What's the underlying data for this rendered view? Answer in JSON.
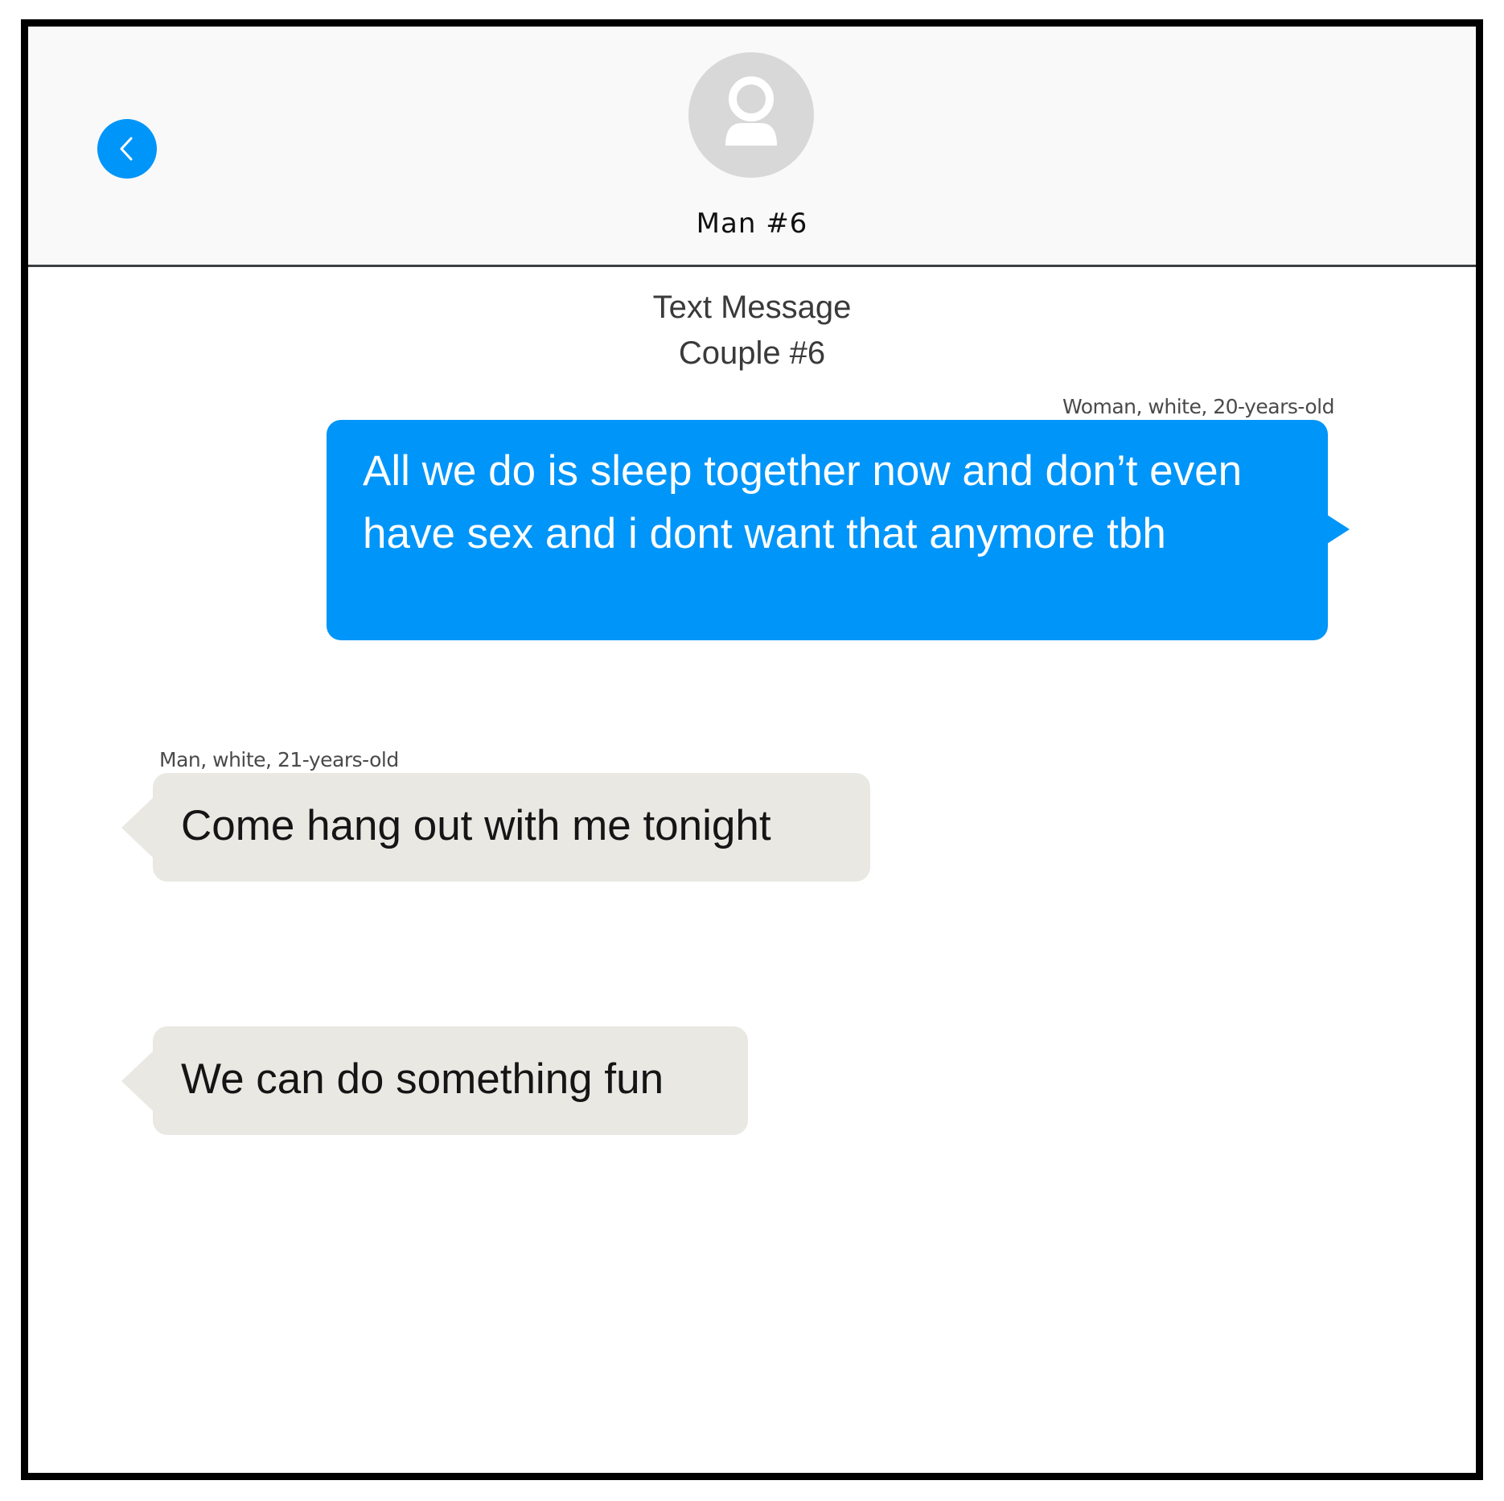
{
  "header": {
    "back_icon": "chevron-left-icon",
    "avatar_icon": "person-icon",
    "contact_name": "Man #6"
  },
  "conversation": {
    "subtitle_line1": "Text Message",
    "subtitle_line2": "Couple #6"
  },
  "messages": [
    {
      "direction": "outgoing",
      "sender": "Woman, white, 20-years-old",
      "text": "All we do is sleep together now and don’t even have sex and i dont want that anymore tbh"
    },
    {
      "direction": "incoming",
      "sender": "Man, white, 21-years-old",
      "text": "Come hang out with me tonight"
    },
    {
      "direction": "incoming",
      "sender": "",
      "text": "We can do something fun"
    }
  ],
  "colors": {
    "outgoing_bubble": "#0095f9",
    "incoming_bubble": "#e9e8e3",
    "header_background": "#f9f9f9",
    "back_button": "#0095f9",
    "avatar_background": "#d8d8d8"
  }
}
